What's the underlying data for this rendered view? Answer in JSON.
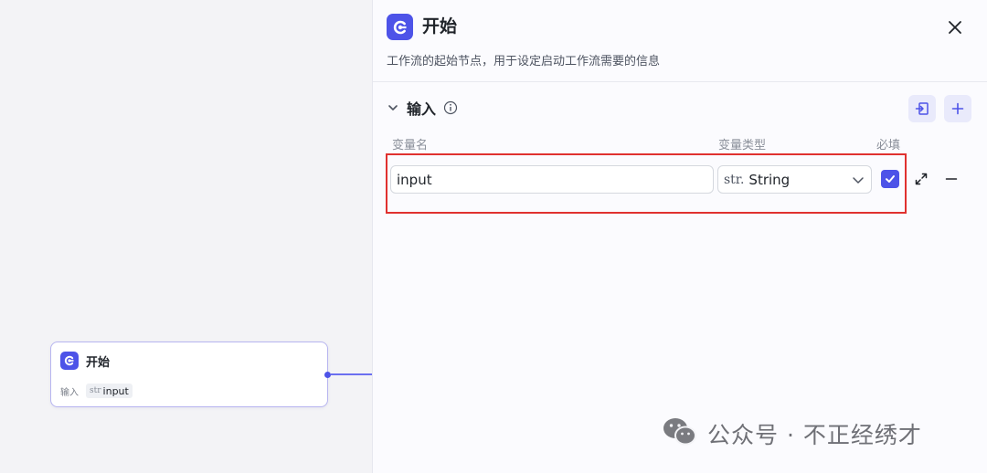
{
  "node": {
    "title": "开始",
    "row_label": "输入",
    "var_type_tag": "str",
    "var_name": "input"
  },
  "panel": {
    "title": "开始",
    "description": "工作流的起始节点，用于设定启动工作流需要的信息",
    "section_title": "输入",
    "columns": {
      "name": "变量名",
      "type": "变量类型",
      "required": "必填"
    },
    "rows": [
      {
        "name": "input",
        "type_prefix": "str.",
        "type": "String",
        "required": true
      }
    ]
  },
  "watermark": {
    "text": "公众号 · 不正经绣才"
  },
  "colors": {
    "accent": "#4d53e8",
    "highlight_border": "#e0312f"
  }
}
